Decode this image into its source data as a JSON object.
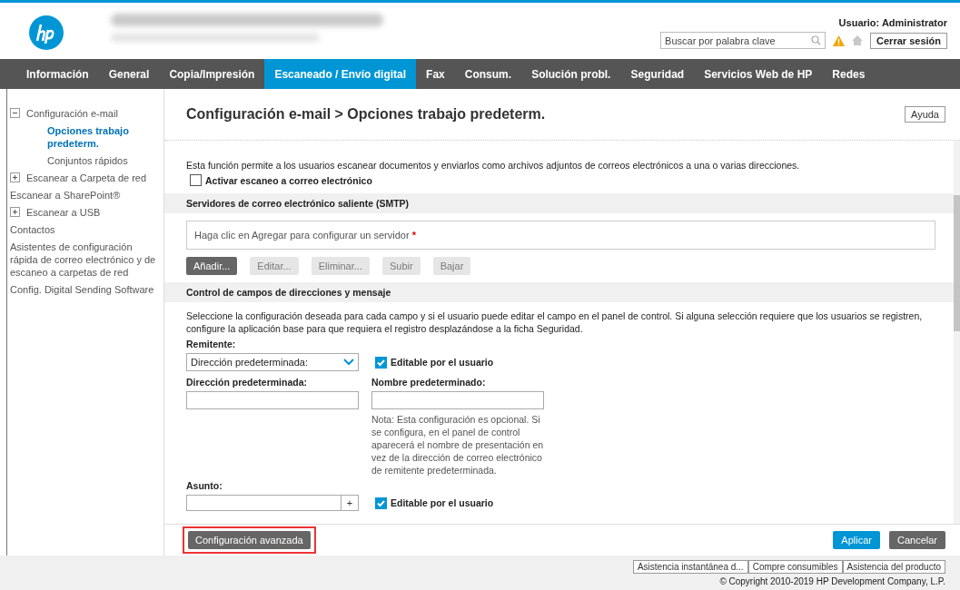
{
  "header": {
    "search": {
      "placeholder": "Buscar por palabra clave"
    },
    "user": "Usuario: Administrator",
    "logout": "Cerrar sesión"
  },
  "tabs": [
    {
      "label": "Información",
      "selected": false
    },
    {
      "label": "General",
      "selected": false
    },
    {
      "label": "Copia/Impresión",
      "selected": false
    },
    {
      "label": "Escaneado / Envío digital",
      "selected": true
    },
    {
      "label": "Fax",
      "selected": false
    },
    {
      "label": "Consum.",
      "selected": false
    },
    {
      "label": "Solución probl.",
      "selected": false
    },
    {
      "label": "Seguridad",
      "selected": false
    },
    {
      "label": "Servicios Web de HP",
      "selected": false
    },
    {
      "label": "Redes",
      "selected": false
    }
  ],
  "sidebar": {
    "items": [
      {
        "label": "Configuración e-mail",
        "kind": "group",
        "expanded": true,
        "selected": false,
        "children": [
          {
            "label": "Opciones trabajo predeterm.",
            "selected": true
          },
          {
            "label": "Conjuntos rápidos",
            "selected": false
          }
        ]
      },
      {
        "label": "Escanear a Carpeta de red",
        "kind": "group",
        "expanded": false,
        "selected": false
      },
      {
        "label": "Escanear a SharePoint®",
        "kind": "link",
        "selected": false
      },
      {
        "label": "Escanear a USB",
        "kind": "group",
        "expanded": false,
        "selected": false
      },
      {
        "label": "Contactos",
        "kind": "link",
        "selected": false
      },
      {
        "label": "Asistentes de configuración rápida de correo electrónico y de escaneo a carpetas de red",
        "kind": "link",
        "selected": false
      },
      {
        "label": "Config. Digital Sending Software",
        "kind": "link",
        "selected": false
      }
    ]
  },
  "page": {
    "title": "Configuración e-mail > Opciones trabajo predeterm.",
    "help": "Ayuda",
    "intro": "Esta función permite a los usuarios escanear documentos y enviarlos como archivos adjuntos de correos electrónicos a una o varias direcciones.",
    "enable": {
      "label": "Activar escaneo a correo electrónico",
      "checked": false
    },
    "smtp": {
      "heading": "Servidores de correo electrónico saliente (SMTP)",
      "placeholder": "Haga clic en Agregar para configurar un servidor",
      "required_mark": "*",
      "buttons": [
        {
          "label": "Añadir...",
          "disabled": false
        },
        {
          "label": "Editar...",
          "disabled": true
        },
        {
          "label": "Eliminar...",
          "disabled": true
        },
        {
          "label": "Subir",
          "disabled": true
        },
        {
          "label": "Bajar",
          "disabled": true
        }
      ]
    },
    "fields": {
      "heading": "Control de campos de direcciones y mensaje",
      "description": "Seleccione la configuración deseada para cada campo y si el usuario puede editar el campo en el panel de control. Si alguna selección requiere que los usuarios se registren, configure la aplicación base para que requiera el registro desplazándose a la ficha Seguridad.",
      "sender": {
        "label": "Remitente:",
        "value": "Dirección predeterminada:",
        "editable": {
          "label": "Editable por el usuario",
          "checked": true
        }
      },
      "default_address": {
        "label": "Dirección predeterminada:"
      },
      "default_name": {
        "label": "Nombre predeterminado:",
        "note": "Nota: Esta configuración es opcional. Si se configura, en el panel de control aparecerá el nombre de presentación en vez de la dirección de correo electrónico de remitente predeterminada."
      },
      "subject": {
        "label": "Asunto:",
        "add": "+",
        "editable": {
          "label": "Editable por el usuario",
          "checked": true
        }
      }
    }
  },
  "actions": {
    "advanced": "Configuración avanzada",
    "apply": "Aplicar",
    "cancel": "Cancelar"
  },
  "footer": {
    "links": [
      "Asistencia instantánea d...",
      "Compre consumibles",
      "Asistencia del producto"
    ],
    "copyright": "© Copyright 2010-2019 HP Development Company, L.P."
  }
}
